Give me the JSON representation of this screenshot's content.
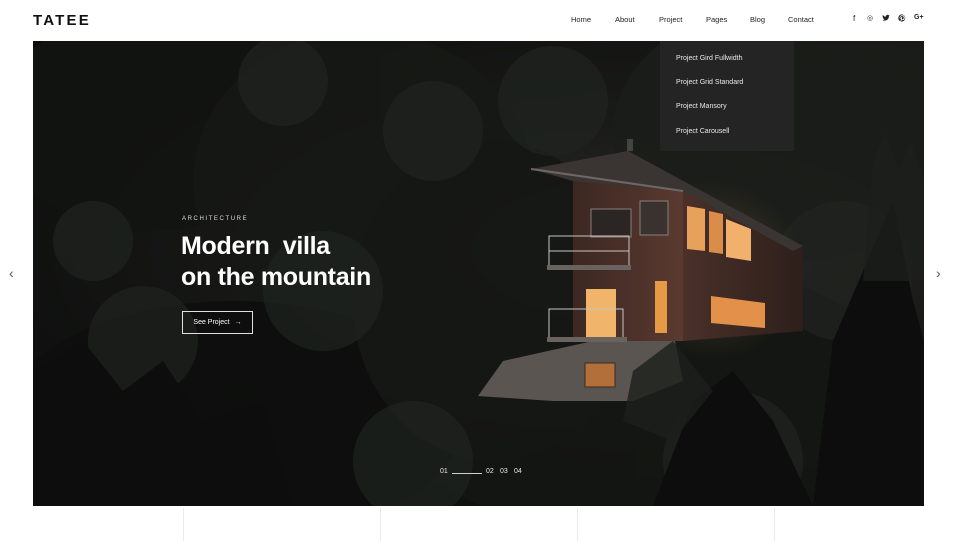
{
  "brand": {
    "logo": "TATEE"
  },
  "nav": {
    "items": [
      {
        "label": "Home"
      },
      {
        "label": "About"
      },
      {
        "label": "Project"
      },
      {
        "label": "Pages"
      },
      {
        "label": "Blog"
      },
      {
        "label": "Contact"
      }
    ]
  },
  "social": {
    "icons": [
      {
        "name": "facebook-icon",
        "glyph": "f"
      },
      {
        "name": "instagram-icon",
        "glyph": "◎"
      },
      {
        "name": "twitter-icon",
        "glyph": "🐦"
      },
      {
        "name": "pinterest-icon",
        "glyph": "℗"
      },
      {
        "name": "google-plus-icon",
        "glyph": "G+"
      }
    ]
  },
  "dropdown": {
    "items": [
      {
        "label": "Project Gird Fullwidth"
      },
      {
        "label": "Project Grid Standard"
      },
      {
        "label": "Project Mansory"
      },
      {
        "label": "Project Carousell"
      }
    ]
  },
  "hero": {
    "kicker": "ARCHITECTURE",
    "title_line1": "Modern  villa",
    "title_line2": "on the mountain",
    "button_label": "See Project",
    "button_icon": "→",
    "prev_icon": "‹",
    "next_icon": "›"
  },
  "pager": {
    "items": [
      "01",
      "02",
      "03",
      "04"
    ]
  },
  "colors": {
    "dropdown_bg": "#242424",
    "hero_dark": "#0f100f",
    "window_glow": "#f2a24a"
  }
}
